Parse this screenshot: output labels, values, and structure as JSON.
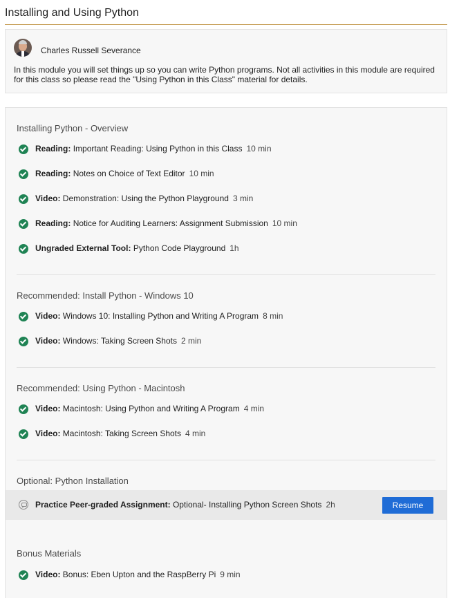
{
  "header": {
    "title": "Installing and Using Python"
  },
  "intro": {
    "instructor_name": "Charles Russell Severance",
    "description": "In this module you will set things up so you can write Python programs. Not all activities in this module are required for this class so please read the \"Using Python in this Class\" material for details."
  },
  "sections": [
    {
      "title": "Installing Python - Overview",
      "items": [
        {
          "kind": "Reading:",
          "title": "Important Reading: Using Python in this Class",
          "duration": "10 min",
          "status": "completed"
        },
        {
          "kind": "Reading:",
          "title": "Notes on Choice of Text Editor",
          "duration": "10 min",
          "status": "completed"
        },
        {
          "kind": "Video:",
          "title": "Demonstration: Using the Python Playground",
          "duration": "3 min",
          "status": "completed"
        },
        {
          "kind": "Reading:",
          "title": "Notice for Auditing Learners: Assignment Submission",
          "duration": "10 min",
          "status": "completed"
        },
        {
          "kind": "Ungraded External Tool:",
          "title": "Python Code Playground",
          "duration": "1h",
          "status": "completed"
        }
      ]
    },
    {
      "title": "Recommended: Install Python - Windows 10",
      "items": [
        {
          "kind": "Video:",
          "title": "Windows 10: Installing Python and Writing A Program",
          "duration": "8 min",
          "status": "completed"
        },
        {
          "kind": "Video:",
          "title": "Windows: Taking Screen Shots",
          "duration": "2 min",
          "status": "completed"
        }
      ]
    },
    {
      "title": "Recommended: Using Python - Macintosh",
      "items": [
        {
          "kind": "Video:",
          "title": "Macintosh: Using Python and Writing A Program",
          "duration": "4 min",
          "status": "completed"
        },
        {
          "kind": "Video:",
          "title": "Macintosh: Taking Screen Shots",
          "duration": "4 min",
          "status": "completed"
        }
      ]
    },
    {
      "title": "Optional: Python Installation",
      "items": [
        {
          "kind": "Practice Peer-graded Assignment:",
          "title": "Optional- Installing Python Screen Shots",
          "duration": "2h",
          "status": "in-progress",
          "action_label": "Resume"
        }
      ]
    },
    {
      "title": "Bonus Materials",
      "items": [
        {
          "kind": "Video:",
          "title": "Bonus: Eben Upton and the RaspBerry Pi",
          "duration": "9 min",
          "status": "completed"
        }
      ]
    }
  ],
  "icons": {
    "completed": "check-circle-icon",
    "in_progress": "peer-review-icon"
  },
  "colors": {
    "completed_check": "#1f8354",
    "resume_button": "#1f6cd6",
    "header_rule": "#c8a05a"
  }
}
